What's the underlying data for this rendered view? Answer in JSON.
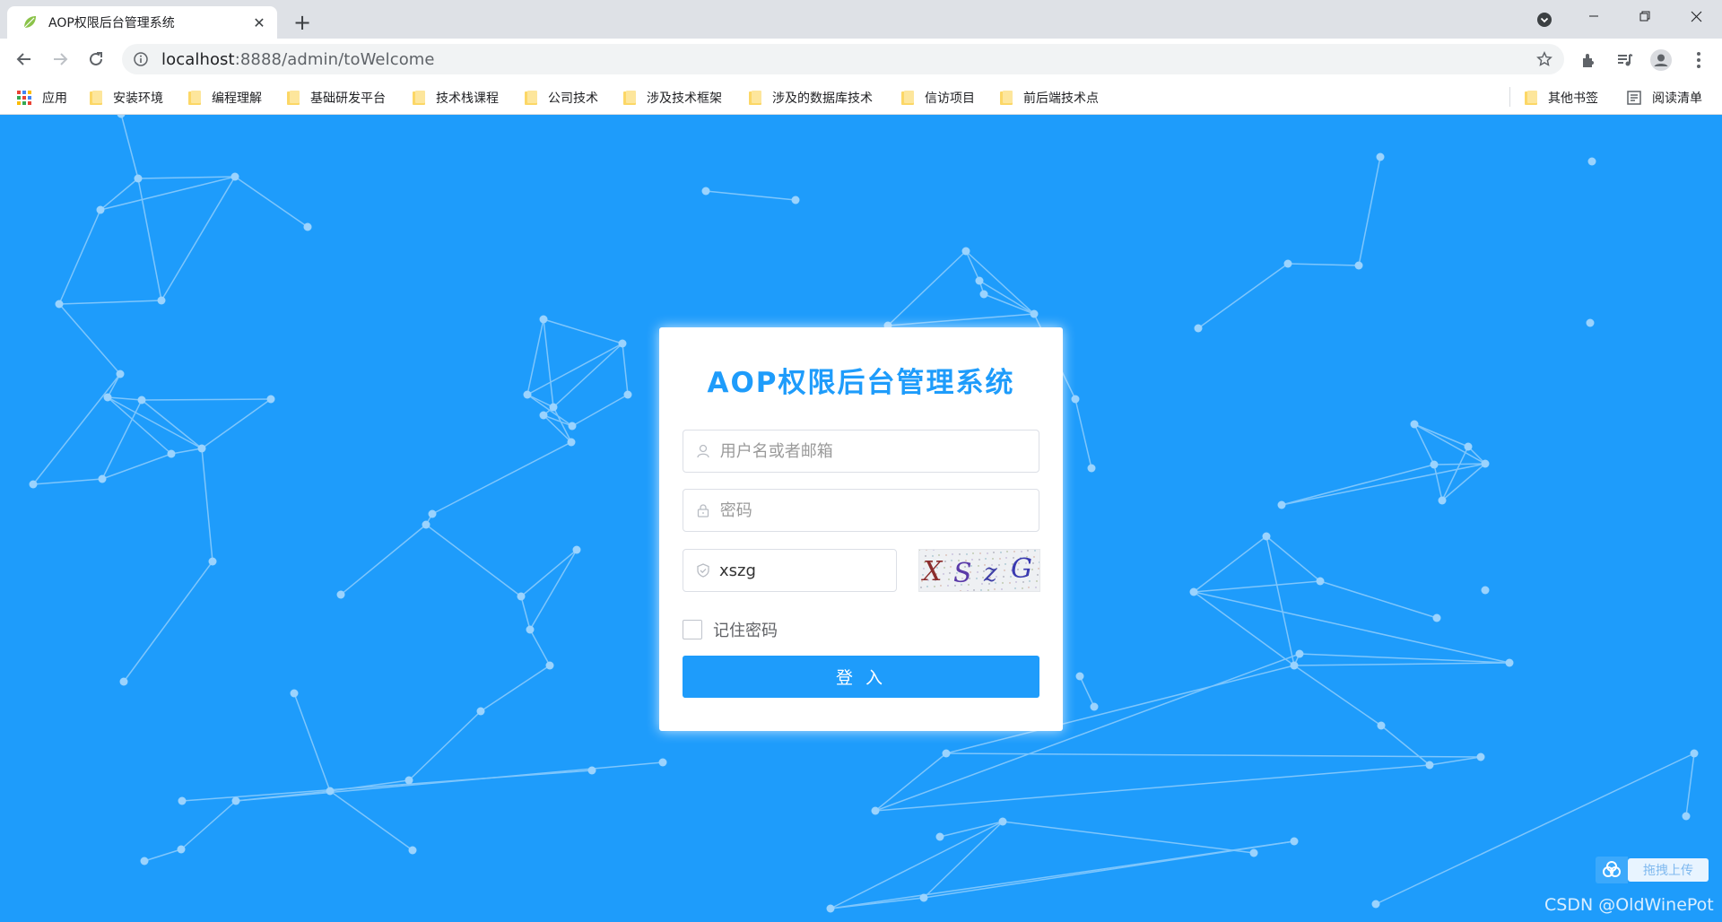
{
  "browser": {
    "tab_title": "AOP权限后台管理系统",
    "url_host": "localhost",
    "url_rest": ":8888/admin/toWelcome",
    "bookmarks": [
      "应用",
      "安装环境",
      "编程理解",
      "基础研发平台",
      "技术栈课程",
      "公司技术",
      "涉及技术框架",
      "涉及的数据库技术",
      "信访项目",
      "前后端技术点"
    ],
    "other_bookmarks": "其他书签",
    "reading_list": "阅读清单"
  },
  "login": {
    "title": "AOP权限后台管理系统",
    "username_placeholder": "用户名或者邮箱",
    "password_placeholder": "密码",
    "captcha_value": "xszg",
    "captcha_image_text": "XSzG",
    "remember_label": "记住密码",
    "submit_label": "登 入"
  },
  "widgets": {
    "upload_label": "拖拽上传",
    "watermark": "CSDN @OldWinePot"
  },
  "colors": {
    "background": "#1e9cfb",
    "accent": "#1e9cfb",
    "network_line": "#7ec6fc",
    "network_dot": "#9bd3fd"
  }
}
